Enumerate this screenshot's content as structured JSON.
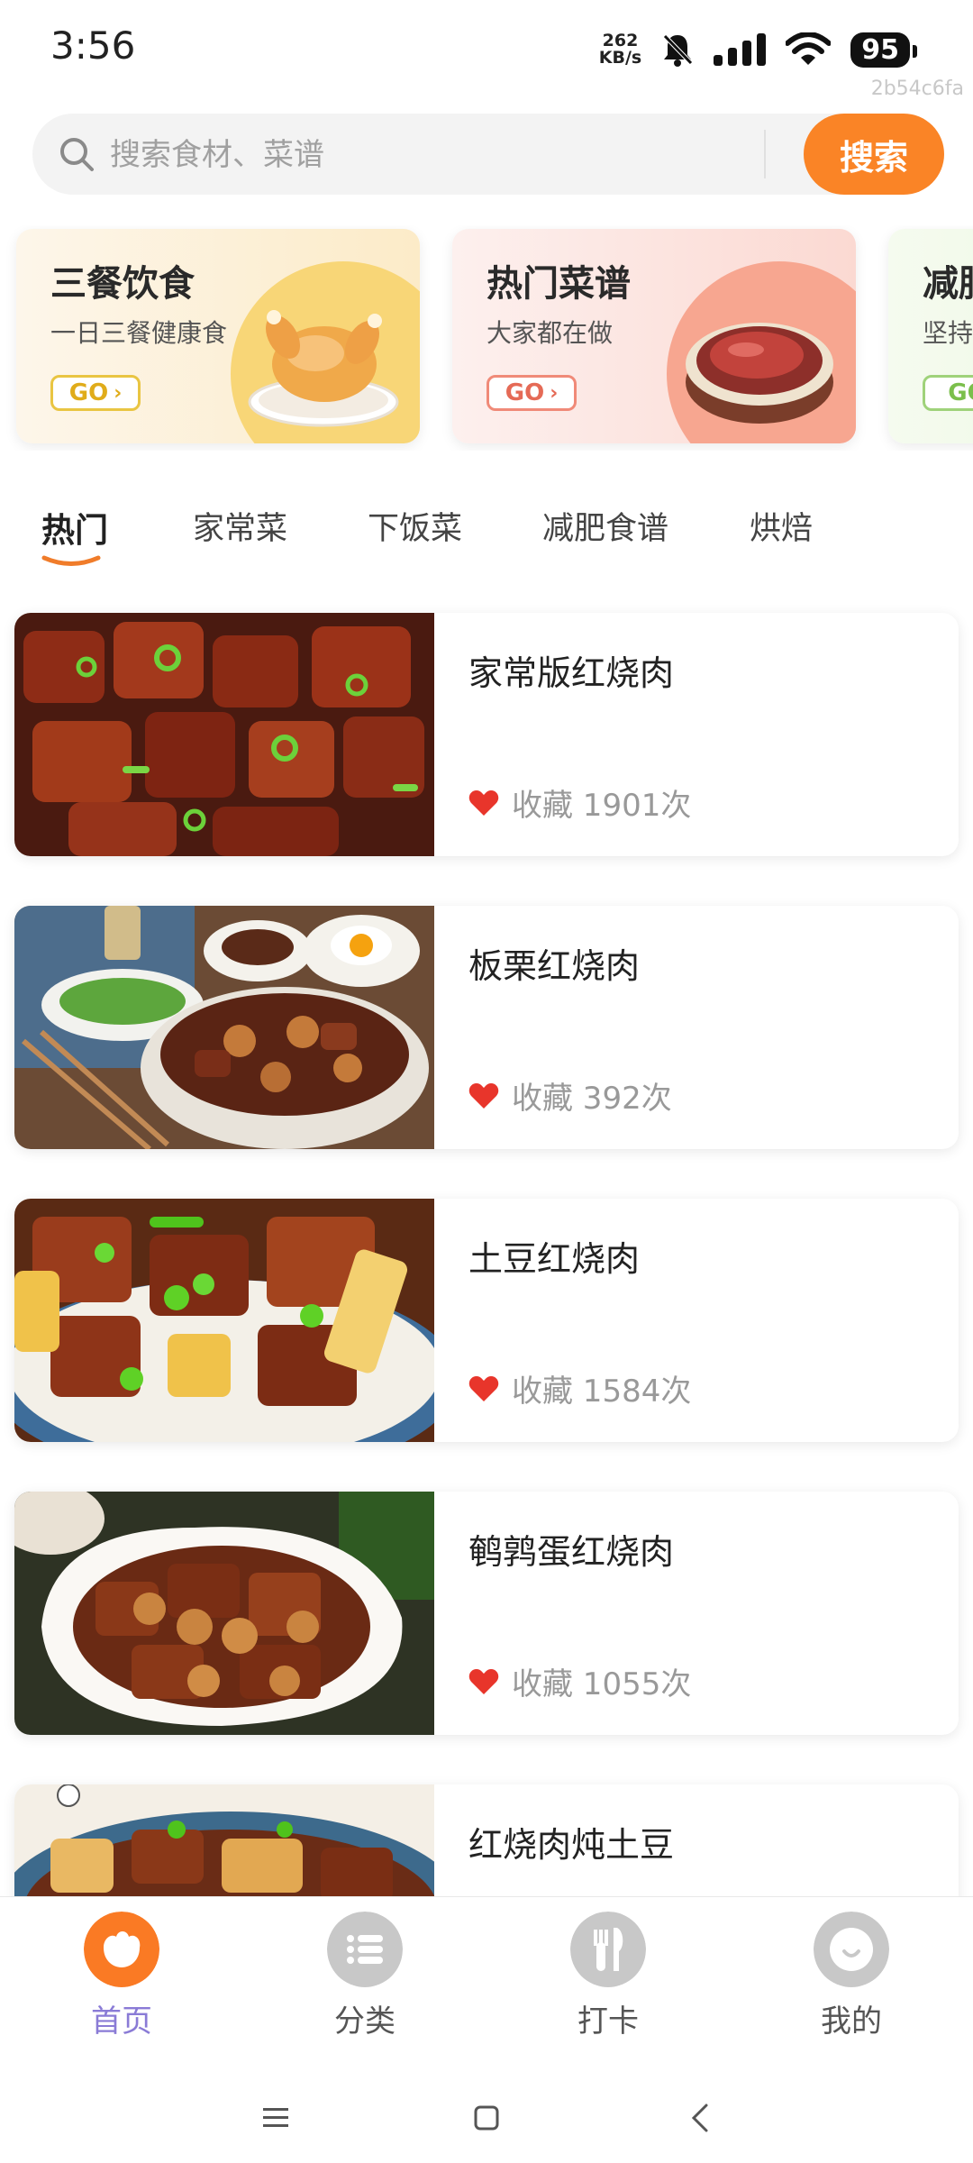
{
  "status_bar": {
    "time": "3:56",
    "net_speed_value": "262",
    "net_speed_unit": "KB/s",
    "battery": "95",
    "icons": [
      "bell-off-icon",
      "signal-icon",
      "wifi-icon",
      "battery-icon"
    ]
  },
  "watermark": "2b54c6fa",
  "search": {
    "placeholder": "搜索食材、菜谱",
    "button_label": "搜索"
  },
  "banners": [
    {
      "title": "三餐饮食",
      "subtitle": "一日三餐健康食",
      "go": "GO",
      "accent": "#f7d66e"
    },
    {
      "title": "热门菜谱",
      "subtitle": "大家都在做",
      "go": "GO",
      "accent": "#f7a38e"
    },
    {
      "title": "减脂",
      "subtitle": "坚持",
      "go": "GO",
      "accent": "#b9e39a"
    }
  ],
  "tabs": [
    {
      "label": "热门",
      "active": true
    },
    {
      "label": "家常菜",
      "active": false
    },
    {
      "label": "下饭菜",
      "active": false
    },
    {
      "label": "减肥食谱",
      "active": false
    },
    {
      "label": "烘焙",
      "active": false
    }
  ],
  "recipes": [
    {
      "title": "家常版红烧肉",
      "fav_text": "收藏 1901次"
    },
    {
      "title": "板栗红烧肉",
      "fav_text": "收藏 392次"
    },
    {
      "title": "土豆红烧肉",
      "fav_text": "收藏 1584次"
    },
    {
      "title": "鹌鹑蛋红烧肉",
      "fav_text": "收藏 1055次"
    },
    {
      "title": "红烧肉炖土豆",
      "fav_text": ""
    }
  ],
  "bottom_nav": [
    {
      "label": "首页",
      "icon": "home-food-icon",
      "active": true
    },
    {
      "label": "分类",
      "icon": "list-icon",
      "active": false
    },
    {
      "label": "打卡",
      "icon": "fork-knife-icon",
      "active": false
    },
    {
      "label": "我的",
      "icon": "profile-icon",
      "active": false
    }
  ],
  "colors": {
    "accent_orange": "#fa8426",
    "active_nav_label": "#8a7bd6",
    "heart_red": "#e8352b"
  }
}
